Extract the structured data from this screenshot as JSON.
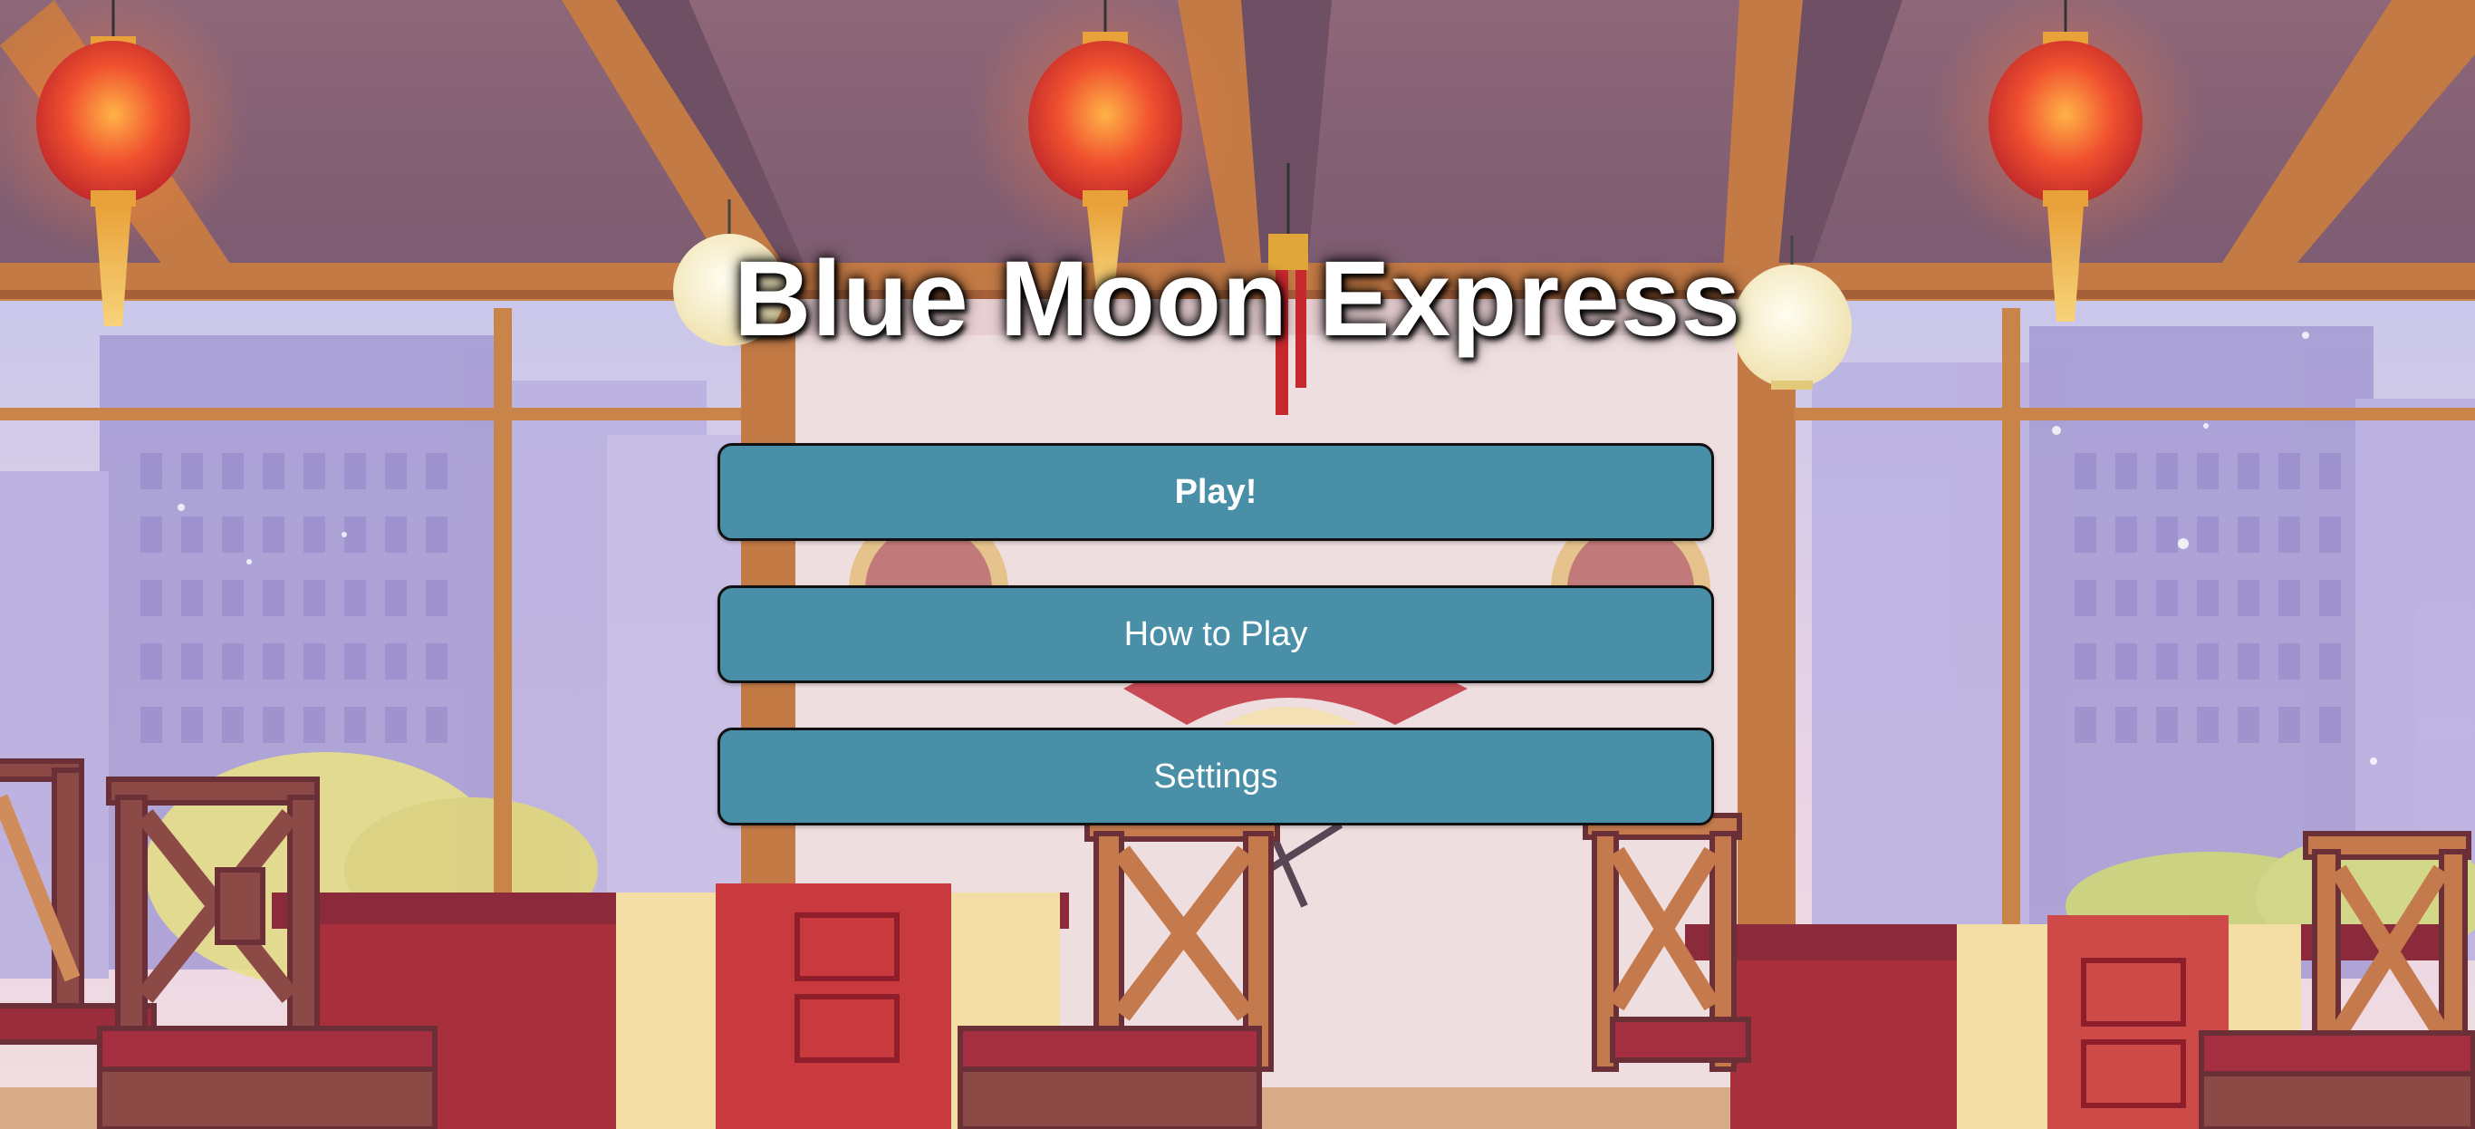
{
  "game": {
    "title": "Blue Moon Express"
  },
  "menu": {
    "play_label": "Play!",
    "how_to_play_label": "How to Play",
    "settings_label": "Settings"
  },
  "colors": {
    "button_fill": "#4a8fa8",
    "button_border": "#111111",
    "title_text": "#ffffff",
    "ceiling": "#8a6578",
    "wood": "#c7743f",
    "lantern_red": "#e8452f",
    "table_red": "#a8303c"
  },
  "icons": [
    "lantern-icon",
    "paper-lantern-icon",
    "chair-icon",
    "table-icon",
    "fan-icon"
  ]
}
